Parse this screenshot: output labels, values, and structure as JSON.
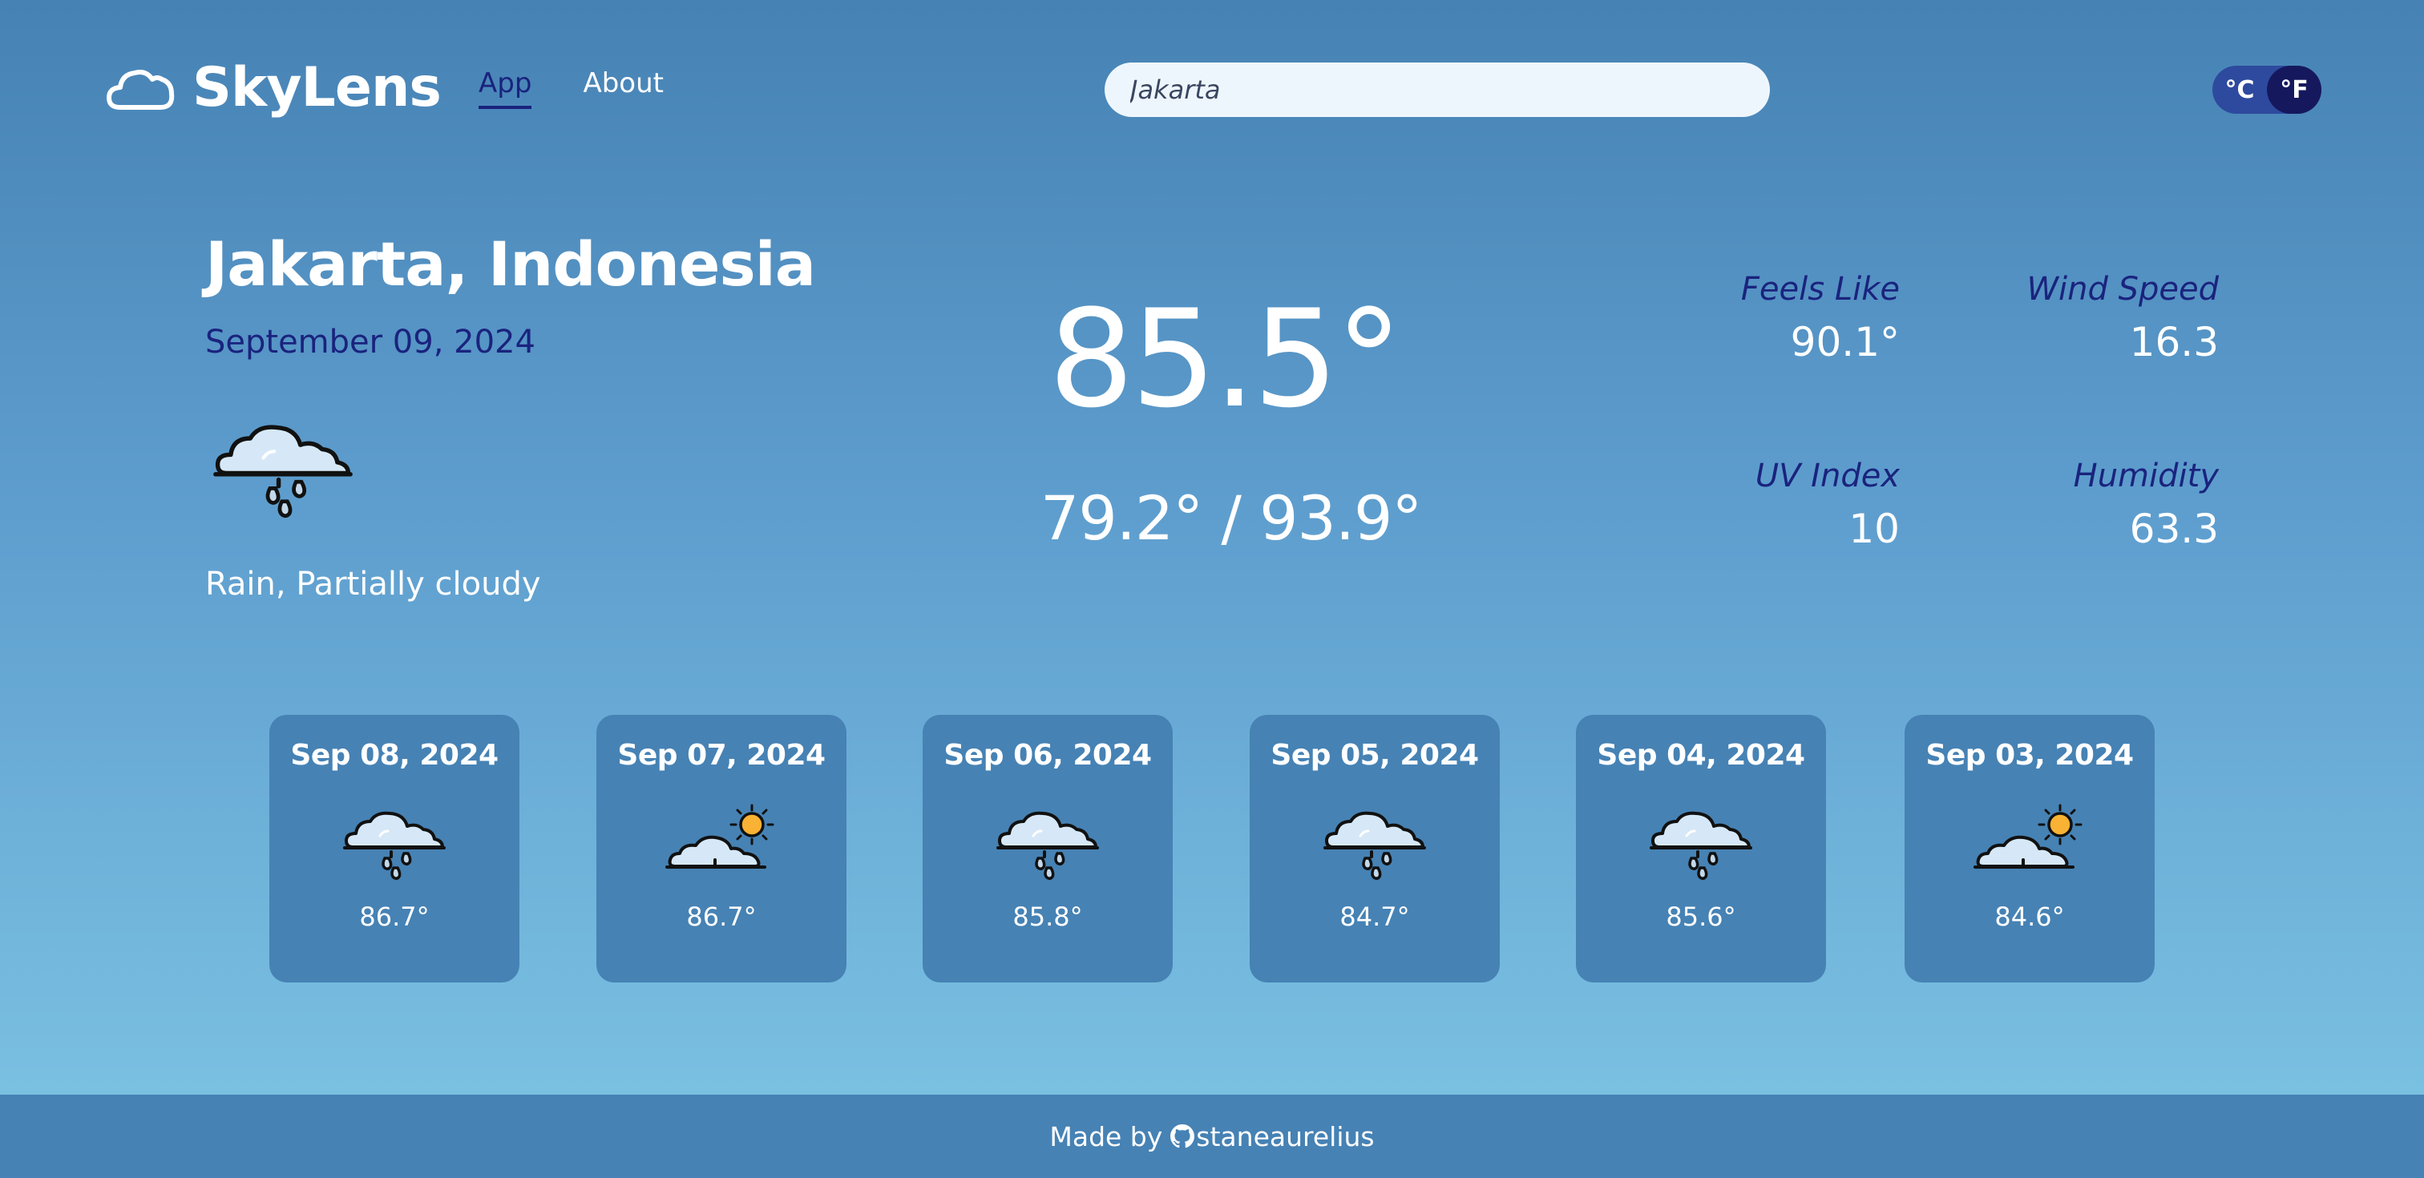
{
  "app": {
    "name": "SkyLens",
    "logo_icon": "cloud-icon"
  },
  "nav": {
    "items": [
      {
        "label": "App",
        "active": true
      },
      {
        "label": "About",
        "active": false
      }
    ]
  },
  "search": {
    "value": "Jakarta",
    "placeholder": "Jakarta"
  },
  "units": {
    "options": [
      "°C",
      "°F"
    ],
    "selected": "°F"
  },
  "current": {
    "location": "Jakarta, Indonesia",
    "date": "September 09, 2024",
    "icon": "rain-cloud-icon",
    "condition": "Rain, Partially cloudy",
    "temperature": "85.5°",
    "range": "79.2° / 93.9°",
    "stats": [
      {
        "label": "Feels Like",
        "value": "90.1°"
      },
      {
        "label": "Wind Speed",
        "value": "16.3"
      },
      {
        "label": "UV Index",
        "value": "10"
      },
      {
        "label": "Humidity",
        "value": "63.3"
      }
    ]
  },
  "forecast": [
    {
      "date": "Sep 08, 2024",
      "icon": "rain-cloud-icon",
      "temp": "86.7°"
    },
    {
      "date": "Sep 07, 2024",
      "icon": "partly-sunny-icon",
      "temp": "86.7°"
    },
    {
      "date": "Sep 06, 2024",
      "icon": "rain-cloud-icon",
      "temp": "85.8°"
    },
    {
      "date": "Sep 05, 2024",
      "icon": "rain-cloud-icon",
      "temp": "84.7°"
    },
    {
      "date": "Sep 04, 2024",
      "icon": "rain-cloud-icon",
      "temp": "85.6°"
    },
    {
      "date": "Sep 03, 2024",
      "icon": "partly-sunny-icon",
      "temp": "84.6°"
    }
  ],
  "footer": {
    "prefix": "Made by",
    "author": "staneaurelius",
    "icon": "github-icon"
  },
  "colors": {
    "background_top": "#4682b4",
    "background_bottom": "#7ec5e4",
    "card": "#4682b4",
    "accent_text": "#1a237e",
    "toggle_bg": "#2e4a9e",
    "toggle_active": "#16185e",
    "sun": "#f9b233"
  }
}
